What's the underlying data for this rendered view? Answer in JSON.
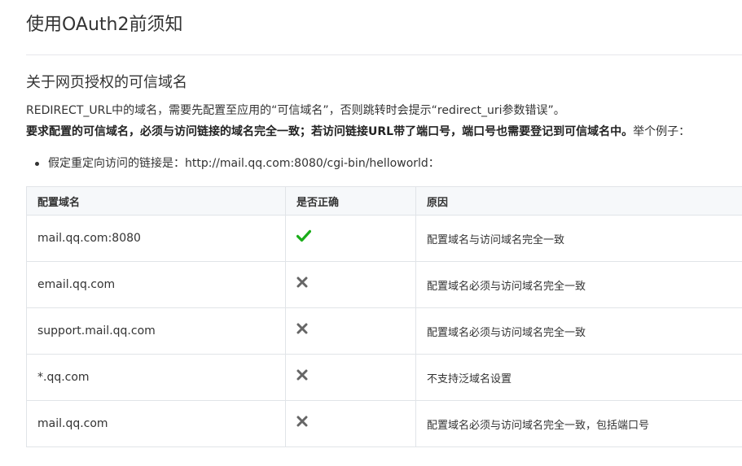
{
  "page": {
    "title": "使用OAuth2前须知"
  },
  "section": {
    "title": "关于网页授权的可信域名",
    "paragraph1": "REDIRECT_URL中的域名，需要先配置至应用的“可信域名”，否则跳转时会提示“redirect_uri参数错误”。",
    "paragraph2_bold": "要求配置的可信域名，必须与访问链接的域名完全一致；若访问链接URL带了端口号，端口号也需要登记到可信域名中。",
    "paragraph2_normal": "举个例子：",
    "bullets": [
      "假定重定向访问的链接是：http://mail.qq.com:8080/cgi-bin/helloworld："
    ]
  },
  "table": {
    "headers": [
      "配置域名",
      "是否正确",
      "原因"
    ],
    "rows": [
      {
        "domain": "mail.qq.com:8080",
        "correct": true,
        "correct_icon": "check-icon",
        "reason": "配置域名与访问域名完全一致"
      },
      {
        "domain": "email.qq.com",
        "correct": false,
        "correct_icon": "cross-icon",
        "reason": "配置域名必须与访问域名完全一致"
      },
      {
        "domain": "support.mail.qq.com",
        "correct": false,
        "correct_icon": "cross-icon",
        "reason": "配置域名必须与访问域名完全一致"
      },
      {
        "domain": "*.qq.com",
        "correct": false,
        "correct_icon": "cross-icon",
        "reason": "不支持泛域名设置"
      },
      {
        "domain": "mail.qq.com",
        "correct": false,
        "correct_icon": "cross-icon",
        "reason": "配置域名必须与访问域名完全一致，包括端口号"
      }
    ]
  },
  "colors": {
    "check": "#1aad19",
    "cross": "#666666"
  }
}
